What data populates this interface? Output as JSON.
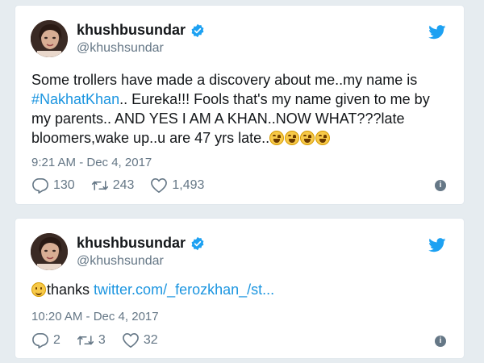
{
  "tweets": [
    {
      "display_name": "khushbusundar",
      "handle": "@khushsundar",
      "text_before_link": "Some trollers have made a discovery about me..my name is ",
      "hashtag": "#NakhatKhan",
      "text_after_link": ".. Eureka!!! Fools that's my name given to me by my parents.. AND YES I AM A KHAN..NOW WHAT???late bloomers,wake up..u are 47 yrs late..",
      "emoji_icons": [
        "rolling-on-floor-laughing-icon",
        "rolling-on-floor-laughing-icon",
        "rolling-on-floor-laughing-icon",
        "rolling-on-floor-laughing-icon"
      ],
      "timestamp": "9:21 AM - Dec 4, 2017",
      "replies": "130",
      "retweets": "243",
      "likes": "1,493"
    },
    {
      "display_name": "khushbusundar",
      "handle": "@khushsundar",
      "emoji_icon": "slightly-smiling-face-icon",
      "text": "thanks ",
      "link": "twitter.com/_ferozkhan_/st...",
      "timestamp": "10:20 AM - Dec 4, 2017",
      "replies": "2",
      "retweets": "3",
      "likes": "32"
    }
  ],
  "colors": {
    "background": "#e6ecf0",
    "card": "#ffffff",
    "twitter_blue": "#1da1f2",
    "link": "#1b95e0",
    "muted": "#657786",
    "text": "#14171a"
  }
}
